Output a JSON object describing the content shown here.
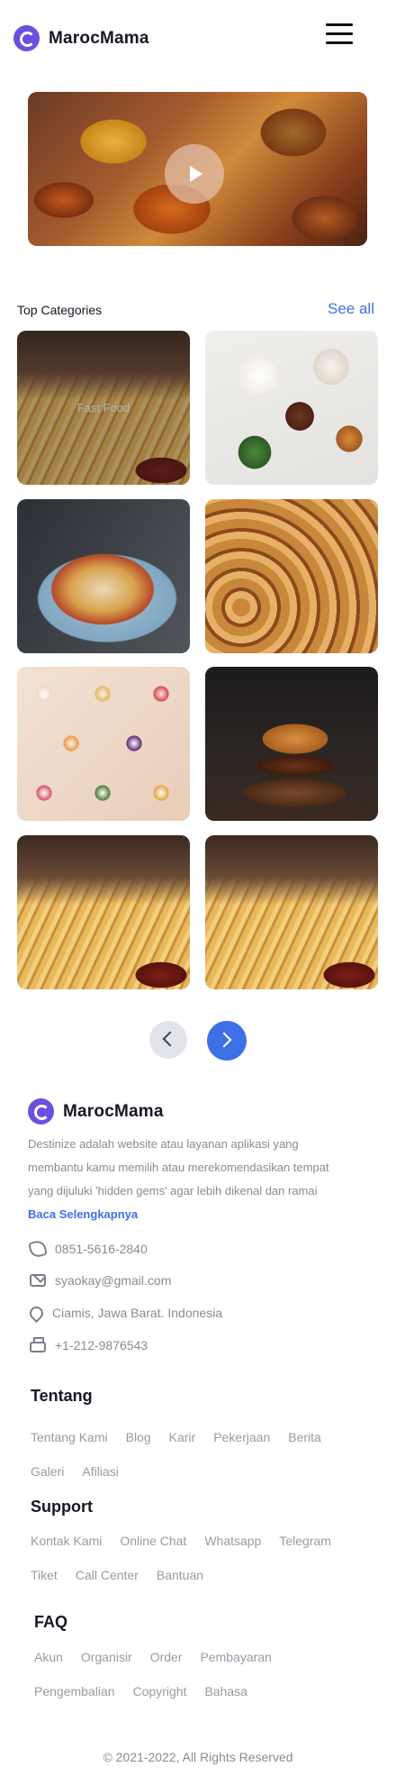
{
  "header": {
    "brand": "MarocMama",
    "logo_icon": "logo-icon",
    "menu_icon": "hamburger-menu-icon"
  },
  "hero": {
    "play_icon": "play-icon"
  },
  "categories": {
    "title": "Top Categories",
    "see_all": "See all",
    "tiles": [
      {
        "label": "Fast Food",
        "image": "fries-burger"
      },
      {
        "label": "",
        "image": "breakfast-spread"
      },
      {
        "label": "",
        "image": "nachos"
      },
      {
        "label": "",
        "image": "croissants"
      },
      {
        "label": "",
        "image": "donuts"
      },
      {
        "label": "",
        "image": "burger"
      },
      {
        "label": "",
        "image": "fries-burger"
      },
      {
        "label": "",
        "image": "fries-burger"
      }
    ]
  },
  "pager": {
    "prev_icon": "chevron-left-icon",
    "next_icon": "chevron-right-icon"
  },
  "footer": {
    "brand": "MarocMama",
    "about_lines": [
      "Destinize adalah website atau layanan aplikasi yang",
      "membantu kamu memilih atau merekomendasikan tempat",
      "yang dijuluki 'hidden gems' agar lebih dikenal dan ramai"
    ],
    "read_more": "Baca Selengkapnya",
    "phone": "0851-5616-2840",
    "email": "syaokay@gmail.com",
    "address": "Ciamis, Jawa Barat. Indonesia",
    "fax": "+1-212-9876543",
    "groups": [
      {
        "title": "Tentang",
        "links": [
          "Tentang Kami",
          "Blog",
          "Karir",
          "Pekerjaan",
          "Berita",
          "Galeri",
          "Afiliasi"
        ]
      },
      {
        "title": "Support",
        "links": [
          "Kontak Kami",
          "Online Chat",
          "Whatsapp",
          "Telegram",
          "Tiket",
          "Call Center",
          "Bantuan"
        ]
      },
      {
        "title": "FAQ",
        "links": [
          "Akun",
          "Organisir",
          "Order",
          "Pembayaran",
          "Pengembalian",
          "Copyright",
          "Bahasa"
        ]
      }
    ],
    "copyright": "© 2021-2022, All Rights Reserved"
  },
  "colors": {
    "accent": "#3d6fe6",
    "brand": "#6c4fe0",
    "muted_text": "#8a8a96"
  }
}
